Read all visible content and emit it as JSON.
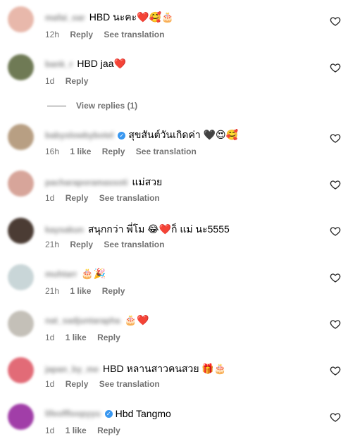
{
  "comments": [
    {
      "username": "mafai_oar",
      "text": "HBD นะคะ❤️🥰🎂",
      "time": "12h",
      "likes": "",
      "reply": "Reply",
      "translate": "See translation",
      "verified": false,
      "avatar_color": "#e8b8ab"
    },
    {
      "username": "bank_r",
      "text": "HBD jaa❤️",
      "time": "1d",
      "likes": "",
      "reply": "Reply",
      "translate": "",
      "verified": false,
      "avatar_color": "#6f7a55"
    },
    {
      "username": "babyslowbybotel",
      "text": "สุขสันต์วันเกิดค่า 🖤😍🥰",
      "time": "16h",
      "likes": "1 like",
      "reply": "Reply",
      "translate": "See translation",
      "verified": true,
      "avatar_color": "#b89f83"
    },
    {
      "username": "pacharaporamassoti",
      "text": "แม่สวย",
      "time": "1d",
      "likes": "",
      "reply": "Reply",
      "translate": "See translation",
      "verified": false,
      "avatar_color": "#d7a59a"
    },
    {
      "username": "kaysakun",
      "text": "สนุกกว่า พี่โม 😂❤️ก็ แม่ นะ5555",
      "time": "21h",
      "likes": "",
      "reply": "Reply",
      "translate": "See translation",
      "verified": false,
      "avatar_color": "#4b3c34"
    },
    {
      "username": "muhtarr",
      "text": "🎂🎉",
      "time": "21h",
      "likes": "1 like",
      "reply": "Reply",
      "translate": "",
      "verified": false,
      "avatar_color": "#c9d6d8"
    },
    {
      "username": "nat_sadjuntarapha",
      "text": "🎂❤️",
      "time": "1d",
      "likes": "1 like",
      "reply": "Reply",
      "translate": "",
      "verified": false,
      "avatar_color": "#c4c0b8"
    },
    {
      "username": "japan_by_me",
      "text": "HBD หลานสาวคนสวย 🎁🎂",
      "time": "1d",
      "likes": "",
      "reply": "Reply",
      "translate": "See translation",
      "verified": false,
      "avatar_color": "#e26b77"
    },
    {
      "username": "lifeoffloopyyu",
      "text": "Hbd Tangmo",
      "time": "1d",
      "likes": "1 like",
      "reply": "Reply",
      "translate": "",
      "verified": true,
      "avatar_color": "#a13ea8"
    }
  ],
  "view_replies": "View replies (1)",
  "icons": {
    "like": "heart-outline-icon",
    "verified": "verified-badge-icon"
  }
}
